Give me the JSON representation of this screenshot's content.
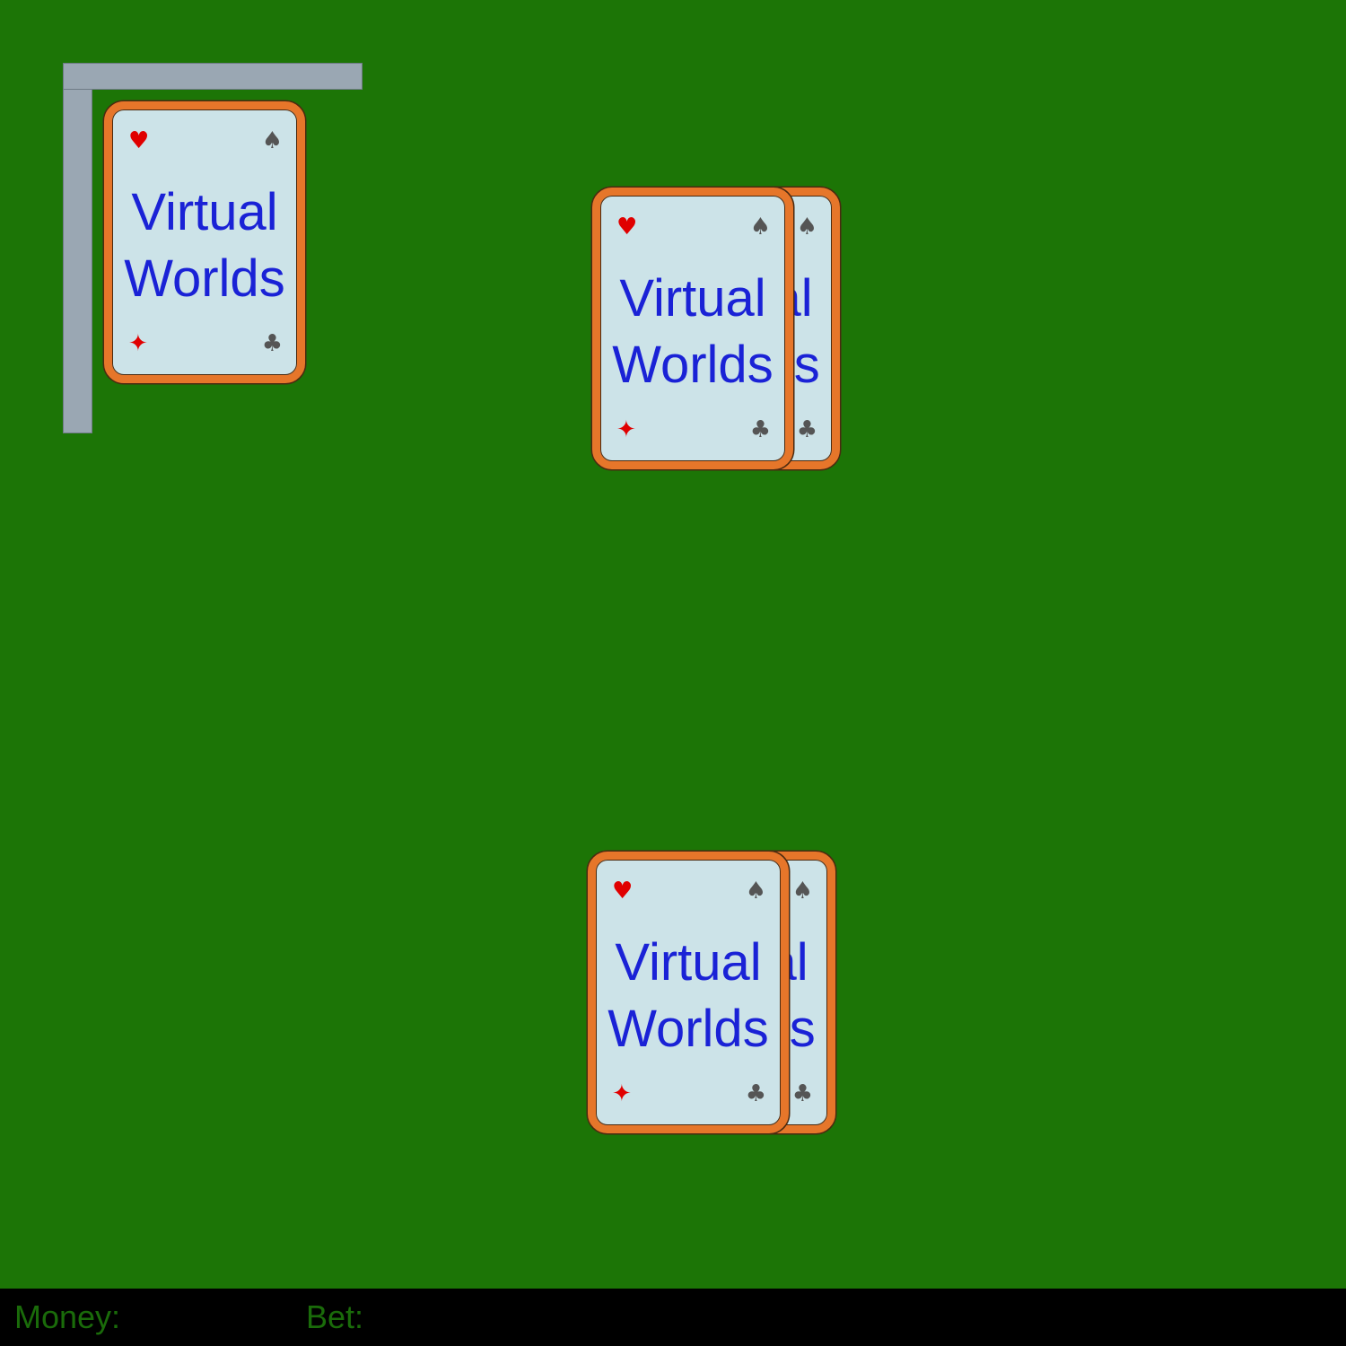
{
  "card_back": {
    "line1": "Virtual",
    "line2": "Worlds",
    "pip_top_left": "♥",
    "pip_top_right": "♠",
    "pip_bottom_left": "✦",
    "pip_bottom_right": "♣"
  },
  "status_bar": {
    "money_label": "Money:",
    "bet_label": "Bet:"
  },
  "colors": {
    "table_felt": "#1c7506",
    "card_border": "#e6762a",
    "card_face": "#cce3e8",
    "card_text": "#1a22d6",
    "status_text": "#1a6b0a"
  }
}
